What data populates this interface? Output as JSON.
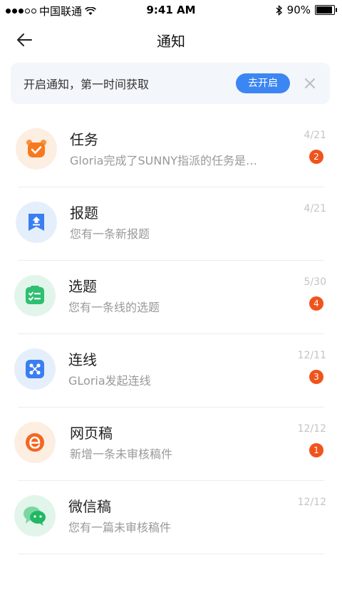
{
  "status_bar": {
    "carrier": "中国联通",
    "time": "9:41 AM",
    "battery": "90%"
  },
  "nav": {
    "title": "通知"
  },
  "banner": {
    "text": "开启通知，第一时间获取",
    "button_label": "去开启"
  },
  "notifications": [
    {
      "title": "任务",
      "subtitle": "Gloria完成了SUNNY指派的任务是…",
      "date": "4/21",
      "badge": "2",
      "icon": "alarm-clock-icon",
      "color": "#fdeee2"
    },
    {
      "title": "报题",
      "subtitle": "您有一条新报题",
      "date": "4/21",
      "badge": "",
      "icon": "report-upload-icon",
      "color": "#e5effc"
    },
    {
      "title": "选题",
      "subtitle": "您有一条线的选题",
      "date": "5/30",
      "badge": "4",
      "icon": "checklist-icon",
      "color": "#e1f5ea"
    },
    {
      "title": "连线",
      "subtitle": "GLoria发起连线",
      "date": "12/11",
      "badge": "3",
      "icon": "connect-dice-icon",
      "color": "#e5effc"
    },
    {
      "title": "网页稿",
      "subtitle": "新增一条未审核稿件",
      "date": "12/12",
      "badge": "1",
      "icon": "browser-e-icon",
      "color": "#fdeee2"
    },
    {
      "title": "微信稿",
      "subtitle": "您有一篇未审核稿件",
      "date": "12/12",
      "badge": "",
      "icon": "wechat-icon",
      "color": "#e1f5ea"
    }
  ]
}
